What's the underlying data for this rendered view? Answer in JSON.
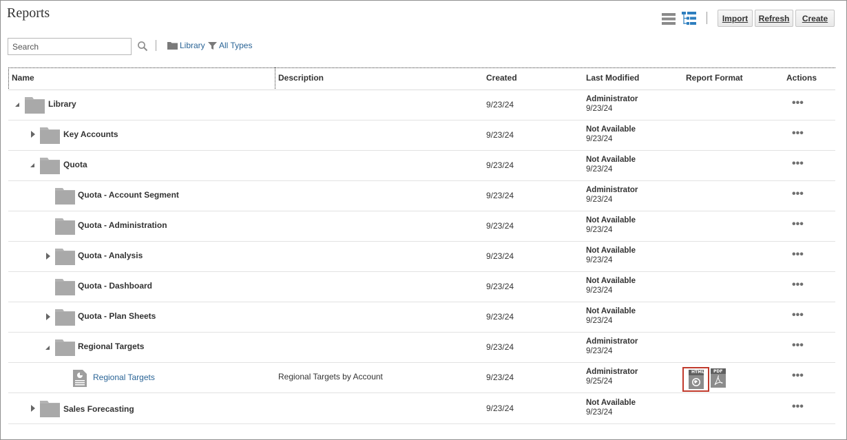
{
  "page": {
    "title": "Reports"
  },
  "toolbar": {
    "view_list_icon": "list-view-icon",
    "view_tree_icon": "tree-view-icon",
    "import_label": "Import",
    "refresh_label": "Refresh",
    "create_label": "Create"
  },
  "search": {
    "placeholder": "Search",
    "value": ""
  },
  "filters": {
    "library_label": "Library",
    "types_label": "All Types"
  },
  "table": {
    "columns": [
      "Name",
      "Description",
      "Created",
      "Last Modified",
      "Report Format",
      "Actions"
    ],
    "rows": [
      {
        "name": "Library",
        "description": "",
        "created": "9/23/24",
        "modified_by": "Administrator",
        "modified_date": "9/23/24",
        "actions": "•••"
      },
      {
        "name": "Key Accounts",
        "description": "",
        "created": "9/23/24",
        "modified_by": "Not Available",
        "modified_date": "9/23/24",
        "actions": "•••"
      },
      {
        "name": "Quota",
        "description": "",
        "created": "9/23/24",
        "modified_by": "Not Available",
        "modified_date": "9/23/24",
        "actions": "•••"
      },
      {
        "name": "Quota - Account Segment",
        "description": "",
        "created": "9/23/24",
        "modified_by": "Administrator",
        "modified_date": "9/23/24",
        "actions": "•••"
      },
      {
        "name": "Quota - Administration",
        "description": "",
        "created": "9/23/24",
        "modified_by": "Not Available",
        "modified_date": "9/23/24",
        "actions": "•••"
      },
      {
        "name": "Quota - Analysis",
        "description": "",
        "created": "9/23/24",
        "modified_by": "Not Available",
        "modified_date": "9/23/24",
        "actions": "•••"
      },
      {
        "name": "Quota - Dashboard",
        "description": "",
        "created": "9/23/24",
        "modified_by": "Not Available",
        "modified_date": "9/23/24",
        "actions": "•••"
      },
      {
        "name": "Quota - Plan Sheets",
        "description": "",
        "created": "9/23/24",
        "modified_by": "Not Available",
        "modified_date": "9/23/24",
        "actions": "•••"
      },
      {
        "name": "Regional Targets",
        "description": "",
        "created": "9/23/24",
        "modified_by": "Administrator",
        "modified_date": "9/23/24",
        "actions": "•••"
      },
      {
        "name": "Regional Targets",
        "description": "Regional Targets by Account",
        "created": "9/23/24",
        "modified_by": "Administrator",
        "modified_date": "9/25/24",
        "formats": [
          "HTML",
          "PDF"
        ],
        "actions": "•••"
      },
      {
        "name": "Sales Forecasting",
        "description": "",
        "created": "9/23/24",
        "modified_by": "Not Available",
        "modified_date": "9/23/24",
        "actions": "•••"
      }
    ]
  },
  "colors": {
    "link": "#2a6496",
    "folder": "#b3b3b3",
    "highlight": "#c0392b"
  }
}
